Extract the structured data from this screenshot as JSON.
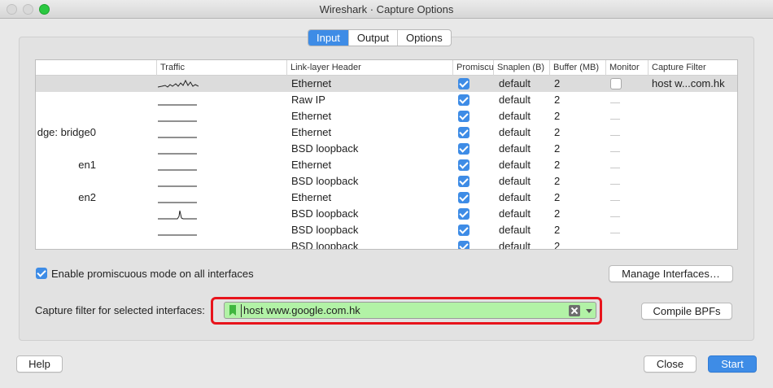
{
  "window": {
    "title": "Wireshark · Capture Options"
  },
  "tabs": [
    {
      "label": "Input",
      "active": true
    },
    {
      "label": "Output",
      "active": false
    },
    {
      "label": "Options",
      "active": false
    }
  ],
  "table": {
    "headers": {
      "traffic": "Traffic",
      "link": "Link-layer Header",
      "promisc": "Promiscuous",
      "snaplen": "Snaplen (B)",
      "buffer": "Buffer (MB)",
      "monitor": "Monitor",
      "filter": "Capture Filter"
    },
    "rows": [
      {
        "name": "",
        "link": "Ethernet",
        "snaplen": "default",
        "buffer": "2",
        "monitor": "checkbox",
        "filter": "host w...com.hk",
        "traffic": "busy"
      },
      {
        "name": "",
        "link": "Raw IP",
        "snaplen": "default",
        "buffer": "2",
        "monitor": "dash",
        "filter": "",
        "traffic": "flat"
      },
      {
        "name": "",
        "link": "Ethernet",
        "snaplen": "default",
        "buffer": "2",
        "monitor": "dash",
        "filter": "",
        "traffic": "flat"
      },
      {
        "name": "dge: bridge0",
        "link": "Ethernet",
        "snaplen": "default",
        "buffer": "2",
        "monitor": "dash",
        "filter": "",
        "traffic": "flat"
      },
      {
        "name": "",
        "link": "BSD loopback",
        "snaplen": "default",
        "buffer": "2",
        "monitor": "dash",
        "filter": "",
        "traffic": "flat"
      },
      {
        "name": "en1",
        "link": "Ethernet",
        "snaplen": "default",
        "buffer": "2",
        "monitor": "dash",
        "filter": "",
        "traffic": "flat"
      },
      {
        "name": "",
        "link": "BSD loopback",
        "snaplen": "default",
        "buffer": "2",
        "monitor": "dash",
        "filter": "",
        "traffic": "flat"
      },
      {
        "name": "en2",
        "link": "Ethernet",
        "snaplen": "default",
        "buffer": "2",
        "monitor": "dash",
        "filter": "",
        "traffic": "flat"
      },
      {
        "name": "",
        "link": "BSD loopback",
        "snaplen": "default",
        "buffer": "2",
        "monitor": "dash",
        "filter": "",
        "traffic": "spike"
      },
      {
        "name": "",
        "link": "BSD loopback",
        "snaplen": "default",
        "buffer": "2",
        "monitor": "dash",
        "filter": "",
        "traffic": "flat"
      },
      {
        "name": "",
        "link": "BSD loopback",
        "snaplen": "default",
        "buffer": "2",
        "monitor": "dash",
        "filter": "",
        "traffic": "flat"
      }
    ]
  },
  "promiscuous_all": {
    "label": "Enable promiscuous mode on all interfaces",
    "checked": true
  },
  "manage_interfaces_button": "Manage Interfaces…",
  "capture_filter": {
    "label": "Capture filter for selected interfaces:",
    "value": "host www.google.com.hk"
  },
  "compile_bpfs_button": "Compile BPFs",
  "footer": {
    "help": "Help",
    "close": "Close",
    "start": "Start"
  },
  "colors": {
    "accent": "#3e8ce6",
    "valid_filter_bg": "#b2f2a6",
    "highlight": "#e8141c"
  }
}
